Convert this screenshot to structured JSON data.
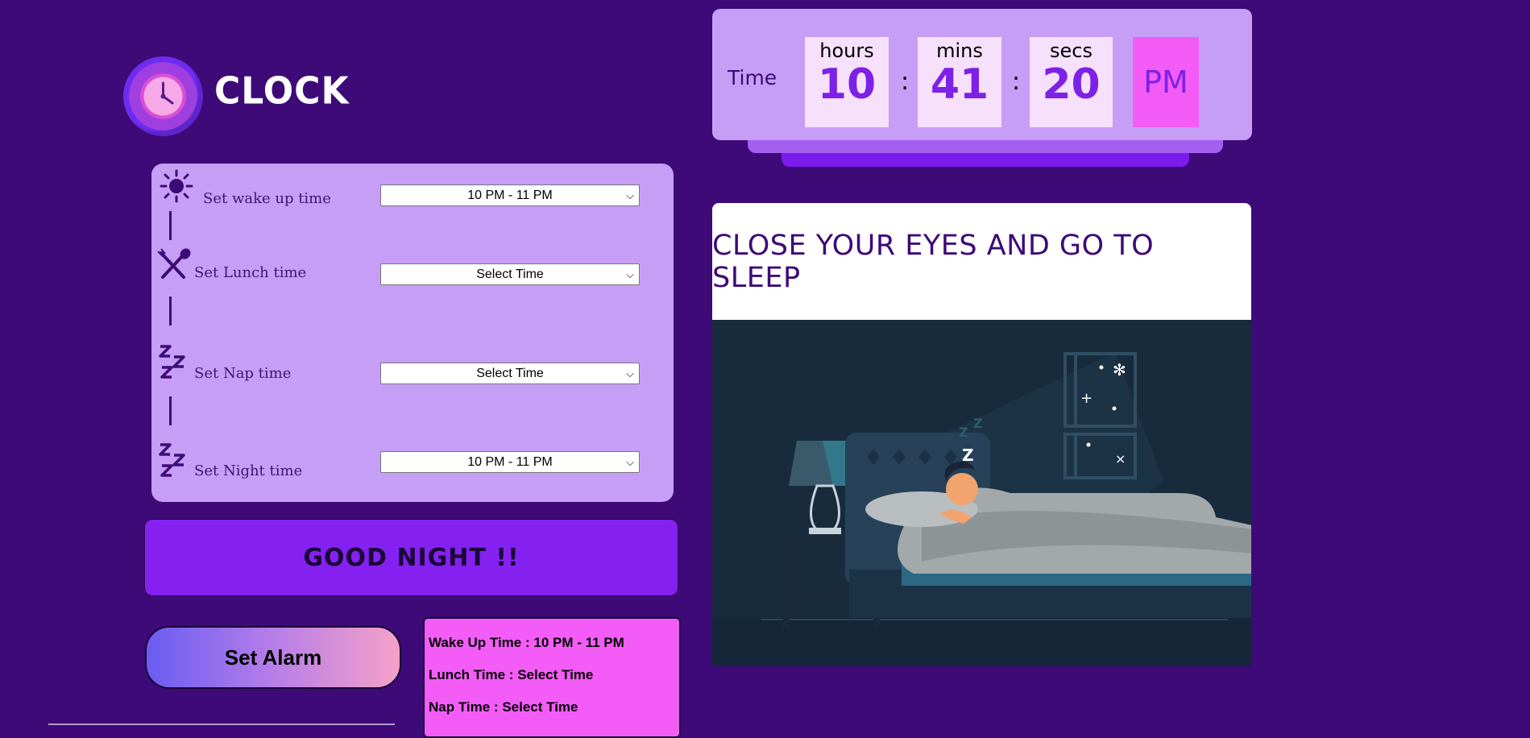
{
  "app": {
    "logo_text": "CLOCK"
  },
  "schedule": {
    "rows": [
      {
        "label": "Set wake up time",
        "selected": "10 PM - 11 PM",
        "icon": "sun-icon"
      },
      {
        "label": "Set Lunch time",
        "selected": "Select Time",
        "icon": "fork-spoon-icon"
      },
      {
        "label": "Set Nap time",
        "selected": "Select Time",
        "icon": "zzz-icon"
      },
      {
        "label": "Set Night time",
        "selected": "10 PM - 11 PM",
        "icon": "zzz-icon"
      }
    ]
  },
  "banner": {
    "text": "GOOD NIGHT !!"
  },
  "alarm_button": {
    "label": "Set Alarm"
  },
  "summary": {
    "wake": "Wake Up Time : 10 PM - 11 PM",
    "lunch": "Lunch Time : Select Time",
    "nap": "Nap Time : Select Time"
  },
  "clock": {
    "label": "Time",
    "hours_label": "hours",
    "hours": "10",
    "mins_label": "mins",
    "mins": "41",
    "secs_label": "secs",
    "secs": "20",
    "sep": ":",
    "ampm": "PM"
  },
  "message": {
    "text": "CLOSE YOUR EYES AND GO TO SLEEP"
  },
  "colors": {
    "background": "#3d0a78",
    "panel": "#c79ef5",
    "accent_purple": "#8421f0",
    "accent_pink": "#f45cf7"
  }
}
